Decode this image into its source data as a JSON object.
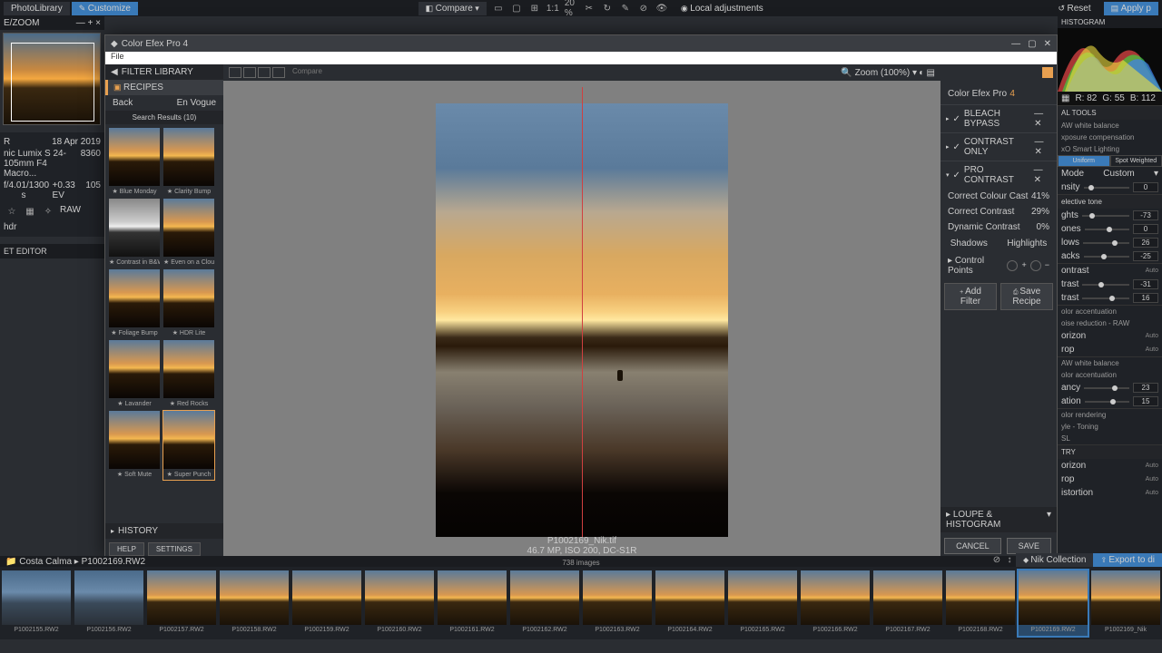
{
  "topbar": {
    "photolibrary": "PhotoLibrary",
    "customize": "Customize",
    "compare": "Compare",
    "zoom_pct": "20 %",
    "fit": "1:1",
    "local_adj": "Local adjustments",
    "reset": "Reset",
    "apply": "Apply p"
  },
  "zoom": {
    "header": "E/ZOOM"
  },
  "meta": {
    "date": "18 Apr 2019",
    "lens": "nic Lumix S 24-105mm F4 Macro...",
    "iso_val": "8360",
    "aperture": "f/4.0",
    "shutter": "1/1300 s",
    "ev": "+0.33 EV",
    "iso": "105",
    "raw": "RAW",
    "hdr": "hdr"
  },
  "preset_editor": "ET EDITOR",
  "plugin": {
    "title": "Color Efex Pro 4",
    "file": "File",
    "filter_library": "FILTER LIBRARY",
    "recipes": "RECIPES",
    "back": "Back",
    "category": "En Vogue",
    "search_results": "Search Results (10)",
    "compare_label": "Compare",
    "zoom": "Zoom (100%)",
    "thumbs": [
      [
        "Blue Monday",
        "Clarity Bump"
      ],
      [
        "Contrast in B&W",
        "Even on a Clou..."
      ],
      [
        "Foliage Bump",
        "HDR Lite"
      ],
      [
        "Lavander",
        "Red Rocks"
      ],
      [
        "Soft Mute",
        "Super Punch"
      ]
    ],
    "history": "HISTORY",
    "help": "HELP",
    "settings": "SETTINGS",
    "filename": "P1002169_Nik.tif",
    "fileinfo": "46.7 MP, ISO 200, DC-S1R",
    "cfx": "Color Efex Pro",
    "cfx_ver": "4",
    "filters": {
      "bleach": "BLEACH BYPASS",
      "contrast_only": "CONTRAST ONLY",
      "pro_contrast": "PRO CONTRAST"
    },
    "sliders": {
      "colour_cast": "Correct Colour Cast",
      "colour_cast_v": "41%",
      "contrast": "Correct Contrast",
      "contrast_v": "29%",
      "dyn": "Dynamic Contrast",
      "dyn_v": "0%"
    },
    "shadows": "Shadows",
    "highlights": "Highlights",
    "control_points": "Control Points",
    "add_filter": "Add Filter",
    "save_recipe": "Save Recipe",
    "loupe": "LOUPE & HISTOGRAM",
    "cancel": "CANCEL",
    "save": "SAVE"
  },
  "rightpanel": {
    "histogram": "HISTOGRAM",
    "rgb": {
      "r": "R:   82",
      "g": "G:   55",
      "b": "B:  112"
    },
    "tools": "AL TOOLS",
    "wb": "AW white balance",
    "exp": "xposure compensation",
    "smart": "xO Smart Lighting",
    "uniform": "Uniform",
    "spot": "Spot Weighted",
    "mode": "Mode",
    "mode_val": "Custom",
    "intensity": "nsity",
    "intensity_v": "0",
    "selective": "elective tone",
    "highlights": "ghts",
    "highlights_v": "-73",
    "midtones": "ones",
    "midtones_v": "0",
    "shadows": "lows",
    "shadows_v": "26",
    "blacks": "acks",
    "blacks_v": "-25",
    "contrast_h": "ontrast",
    "contrast_auto": "Auto",
    "contrast": "trast",
    "contrast_v": "-31",
    "contrast2": "trast",
    "contrast2_v": "16",
    "accent": "olor accentuation",
    "noise": "oise reduction - RAW",
    "horizon": "orizon",
    "horizon_v": "Auto",
    "crop": "rop",
    "crop_v": "Auto",
    "wb2": "AW white balance",
    "accent2": "olor accentuation",
    "vibrancy": "ancy",
    "vibrancy_v": "23",
    "saturation": "ation",
    "saturation_v": "15",
    "rendering": "olor rendering",
    "style": "yle - Toning",
    "hsl": "SL",
    "try": "TRY",
    "horizon2": "orizon",
    "horizon2_v": "Auto",
    "crop2": "rop",
    "crop2_v": "Auto",
    "distortion": "istortion",
    "distortion_v": "Auto"
  },
  "path": "Costa Calma ▸ P1002169.RW2",
  "count": "738 images",
  "nik_collection": "Nik Collection",
  "export": "Export to di",
  "film_items": [
    {
      "name": "P1002155.RW2",
      "style": "blue"
    },
    {
      "name": "P1002156.RW2",
      "style": "blue"
    },
    {
      "name": "P1002157.RW2",
      "style": ""
    },
    {
      "name": "P1002158.RW2",
      "style": ""
    },
    {
      "name": "P1002159.RW2",
      "style": ""
    },
    {
      "name": "P1002160.RW2",
      "style": ""
    },
    {
      "name": "P1002161.RW2",
      "style": ""
    },
    {
      "name": "P1002162.RW2",
      "style": ""
    },
    {
      "name": "P1002163.RW2",
      "style": ""
    },
    {
      "name": "P1002164.RW2",
      "style": ""
    },
    {
      "name": "P1002165.RW2",
      "style": ""
    },
    {
      "name": "P1002166.RW2",
      "style": ""
    },
    {
      "name": "P1002167.RW2",
      "style": ""
    },
    {
      "name": "P1002168.RW2",
      "style": ""
    },
    {
      "name": "P1002169.RW2",
      "style": "",
      "selected": true
    },
    {
      "name": "P1002169_Nik",
      "style": ""
    }
  ]
}
